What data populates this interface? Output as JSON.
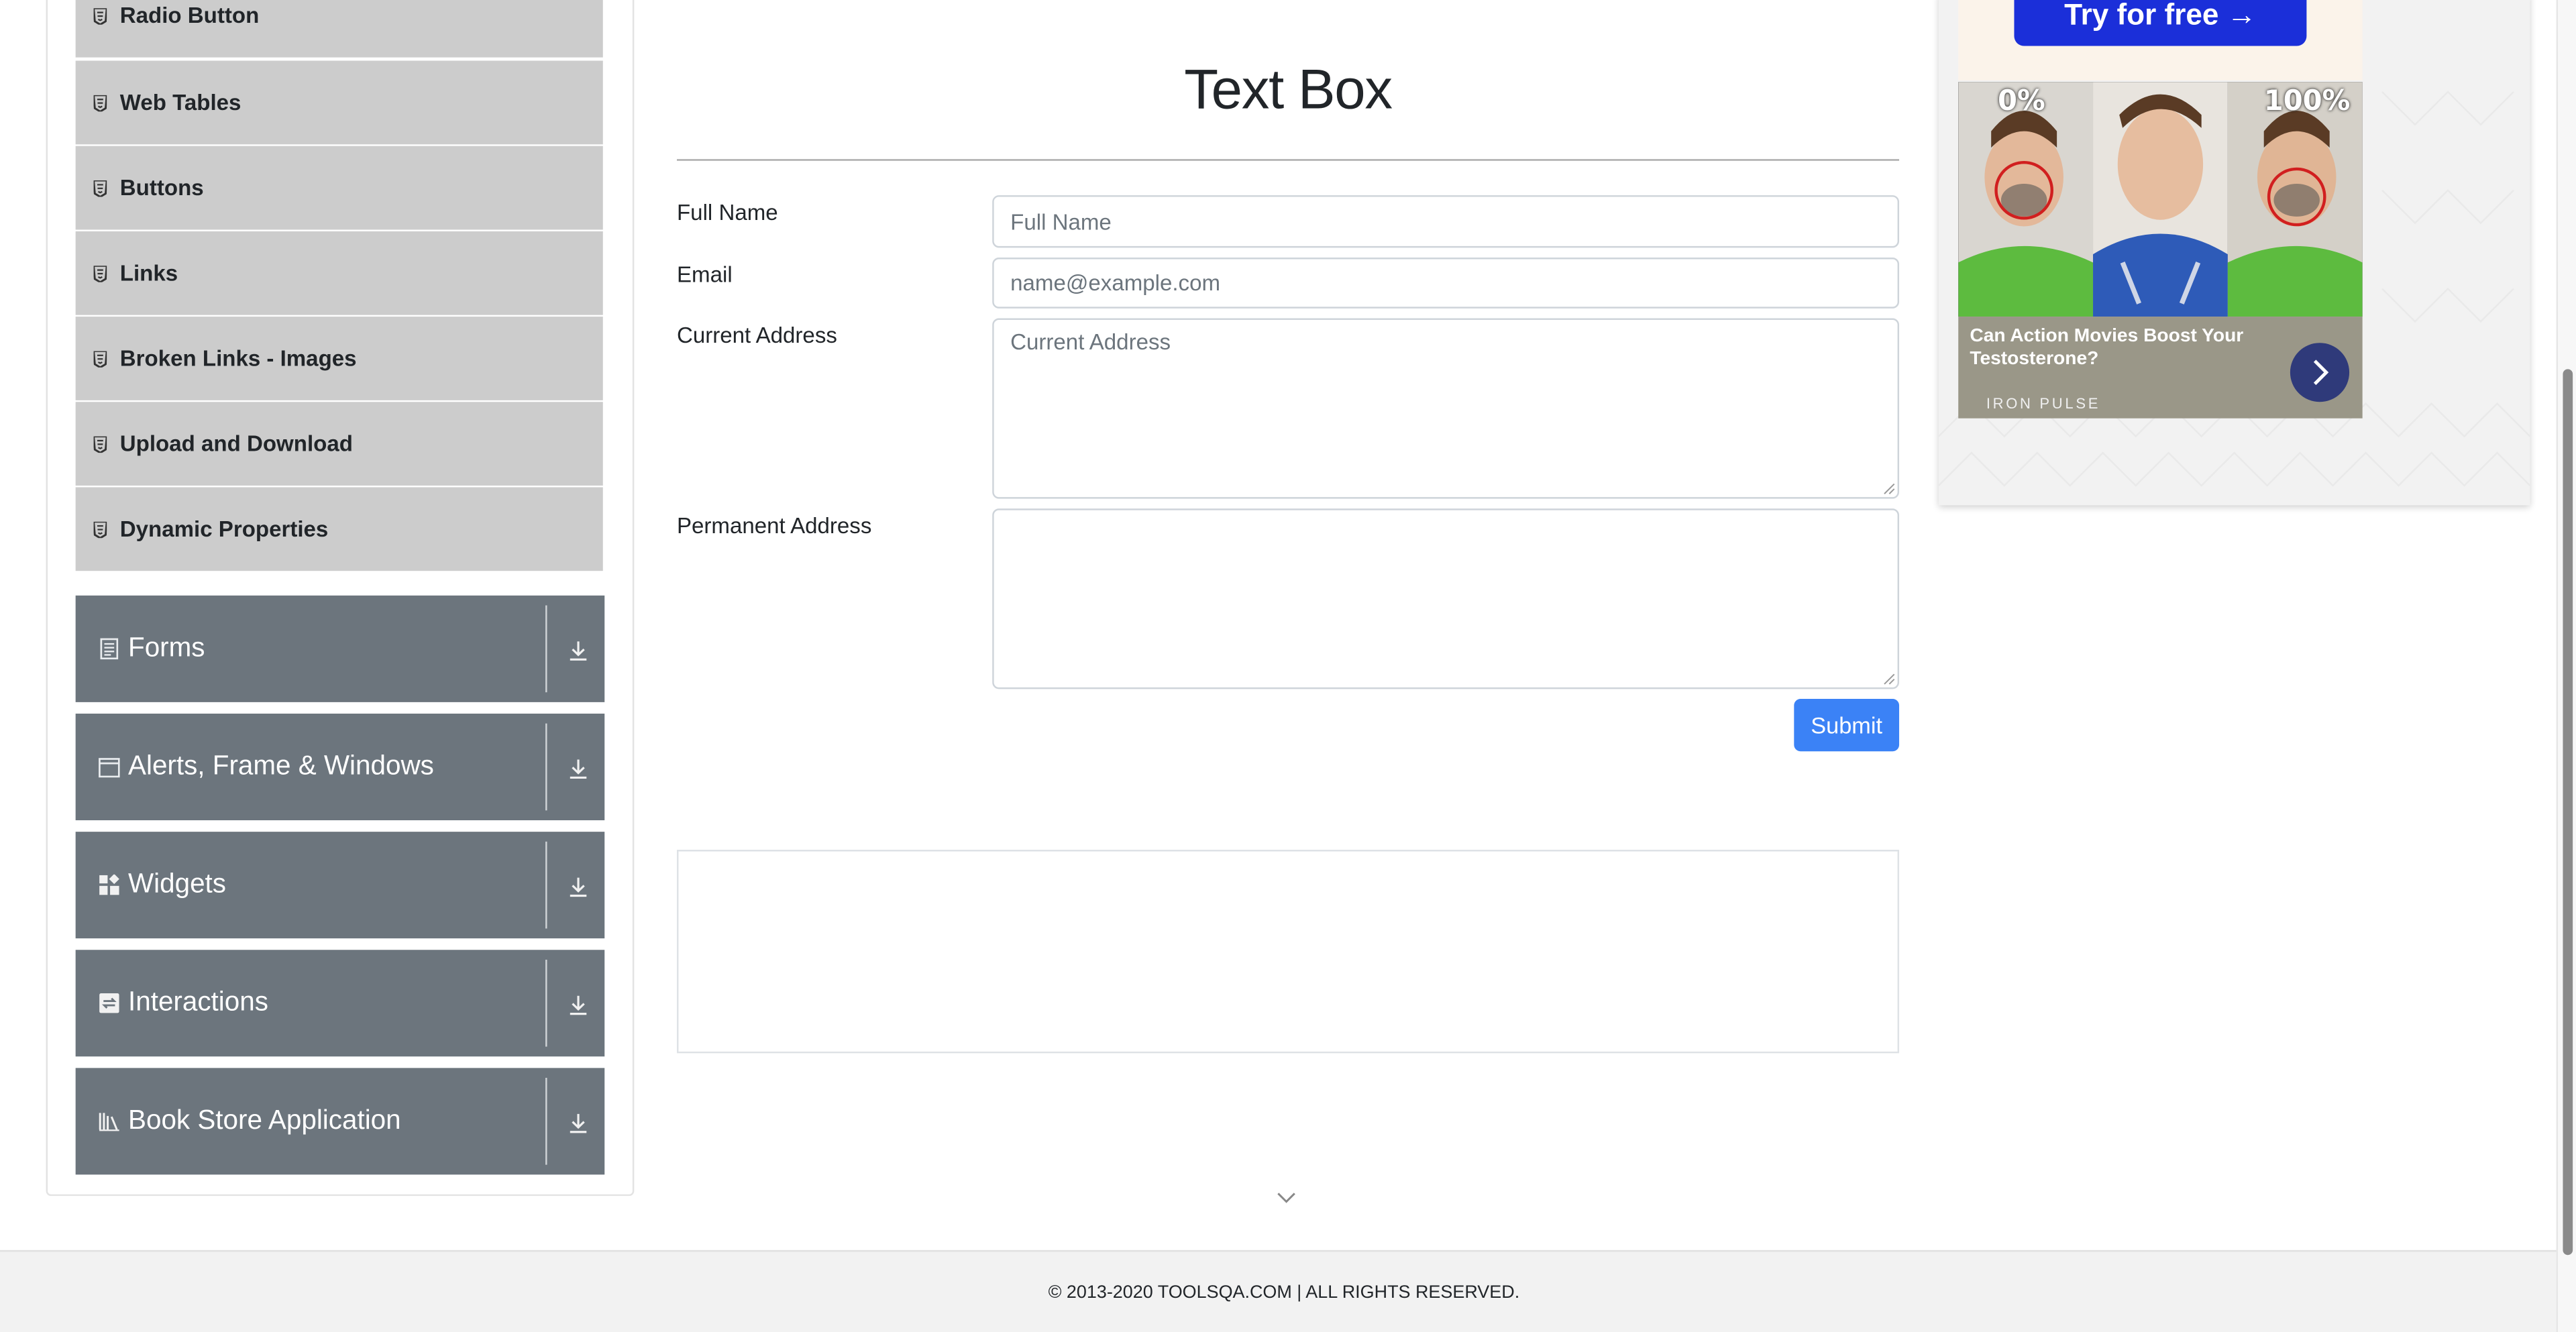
{
  "sidebar": {
    "sub_items": [
      {
        "label": "Radio Button"
      },
      {
        "label": "Web Tables"
      },
      {
        "label": "Buttons"
      },
      {
        "label": "Links"
      },
      {
        "label": "Broken Links - Images"
      },
      {
        "label": "Upload and Download"
      },
      {
        "label": "Dynamic Properties"
      }
    ],
    "groups": [
      {
        "label": "Forms",
        "icon": "document-icon"
      },
      {
        "label": "Alerts, Frame & Windows",
        "icon": "window-icon"
      },
      {
        "label": "Widgets",
        "icon": "widgets-icon"
      },
      {
        "label": "Interactions",
        "icon": "interactions-icon"
      },
      {
        "label": "Book Store Application",
        "icon": "books-icon"
      }
    ]
  },
  "main": {
    "title": "Text Box",
    "form": {
      "full_name": {
        "label": "Full Name",
        "placeholder": "Full Name",
        "value": ""
      },
      "email": {
        "label": "Email",
        "placeholder": "name@example.com",
        "value": ""
      },
      "current_address": {
        "label": "Current Address",
        "placeholder": "Current Address",
        "value": ""
      },
      "permanent_address": {
        "label": "Permanent Address",
        "placeholder": "",
        "value": ""
      },
      "submit_label": "Submit"
    }
  },
  "ad": {
    "cta": "Try for free →",
    "left_percent": "0%",
    "right_percent": "100%",
    "headline": "Can Action Movies Boost Your Testosterone?",
    "brand": "IRON PULSE"
  },
  "footer": {
    "text": "© 2013-2020 TOOLSQA.COM | ALL RIGHTS RESERVED."
  },
  "colors": {
    "accent": "#3b82f6",
    "group_header": "#6c757d",
    "sub_item": "#cccccc"
  }
}
